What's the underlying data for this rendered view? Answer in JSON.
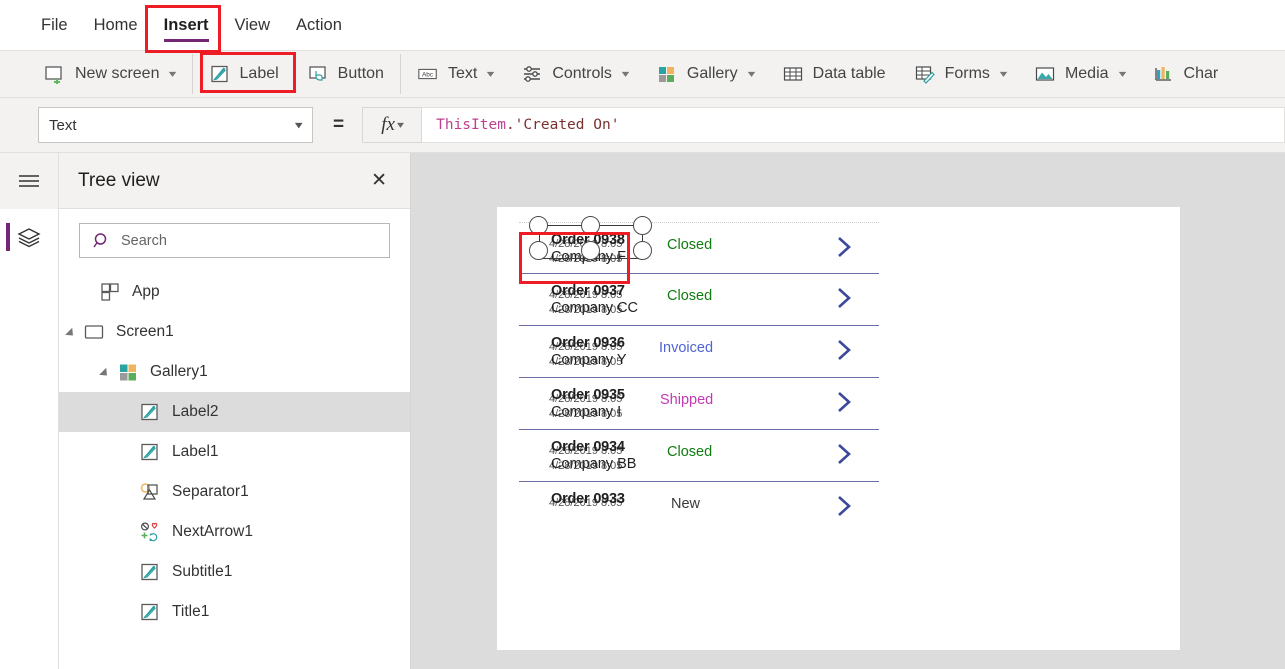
{
  "menu": {
    "items": [
      {
        "label": "File",
        "active": false
      },
      {
        "label": "Home",
        "active": false
      },
      {
        "label": "Insert",
        "active": true
      },
      {
        "label": "View",
        "active": false
      },
      {
        "label": "Action",
        "active": false
      }
    ]
  },
  "ribbon": {
    "items": [
      {
        "label": "New screen",
        "icon": "new-screen-icon",
        "caret": true
      },
      {
        "label": "Label",
        "icon": "label-icon",
        "caret": false
      },
      {
        "label": "Button",
        "icon": "button-icon",
        "caret": false
      },
      {
        "label": "Text",
        "icon": "text-abc-icon",
        "caret": true
      },
      {
        "label": "Controls",
        "icon": "controls-sliders-icon",
        "caret": true
      },
      {
        "label": "Gallery",
        "icon": "gallery-squares-icon",
        "caret": true
      },
      {
        "label": "Data table",
        "icon": "data-table-icon",
        "caret": false
      },
      {
        "label": "Forms",
        "icon": "forms-icon",
        "caret": true
      },
      {
        "label": "Media",
        "icon": "media-image-icon",
        "caret": true
      },
      {
        "label": "Char",
        "icon": "charts-bar-icon",
        "caret": false
      }
    ]
  },
  "formula_bar": {
    "property": "Text",
    "equals": "=",
    "fx": "fx",
    "formula_this_item": "ThisItem",
    "formula_property": ".'Created On'"
  },
  "tree_panel": {
    "title": "Tree view",
    "close_label": "✕",
    "search_placeholder": "Search",
    "items": [
      {
        "label": "App",
        "icon": "app-icon",
        "indent": 0,
        "twisty": false,
        "selected": false
      },
      {
        "label": "Screen1",
        "icon": "screen-icon",
        "indent": 0,
        "twisty": true,
        "selected": false
      },
      {
        "label": "Gallery1",
        "icon": "gallery-squares-icon",
        "indent": 1,
        "twisty": true,
        "selected": false
      },
      {
        "label": "Label2",
        "icon": "label-icon",
        "indent": 2,
        "twisty": false,
        "selected": true
      },
      {
        "label": "Label1",
        "icon": "label-icon",
        "indent": 2,
        "twisty": false,
        "selected": false
      },
      {
        "label": "Separator1",
        "icon": "separator-shape-icon",
        "indent": 2,
        "twisty": false,
        "selected": false
      },
      {
        "label": "NextArrow1",
        "icon": "icons-group-icon",
        "indent": 2,
        "twisty": false,
        "selected": false
      },
      {
        "label": "Subtitle1",
        "icon": "label-icon",
        "indent": 2,
        "twisty": false,
        "selected": false
      },
      {
        "label": "Title1",
        "icon": "label-icon",
        "indent": 2,
        "twisty": false,
        "selected": false
      }
    ]
  },
  "canvas": {
    "gallery_rows": [
      {
        "title": "Order 0938",
        "subtitle": "Company F",
        "date": "4/28/2019 8:05",
        "status": "Closed",
        "status_color": "#107c10",
        "selected": true
      },
      {
        "title": "Order 0937",
        "subtitle": "Company CC",
        "date": "4/28/2019 8:05",
        "status": "Closed",
        "status_color": "#107c10",
        "selected": false
      },
      {
        "title": "Order 0936",
        "subtitle": "Company Y",
        "date": "4/28/2019 8:05",
        "status": "Invoiced",
        "status_color": "#4f63d2",
        "selected": false
      },
      {
        "title": "Order 0935",
        "subtitle": "Company I",
        "date": "4/28/2019 8:05",
        "status": "Shipped",
        "status_color": "#c239b3",
        "selected": false
      },
      {
        "title": "Order 0934",
        "subtitle": "Company BB",
        "date": "4/28/2019 8:05",
        "status": "Closed",
        "status_color": "#107c10",
        "selected": false
      },
      {
        "title": "Order 0933",
        "subtitle": "",
        "date": "4/28/2019 8:05",
        "status": "New",
        "status_color": "#3b3a39",
        "selected": false
      }
    ]
  },
  "colors": {
    "accent_purple": "#742774",
    "annotation_red": "#ee1c25",
    "chevron_blue": "#3b4a9c",
    "ribbon_bg": "#f3f2f1",
    "canvas_bg": "#dcdcdc"
  }
}
